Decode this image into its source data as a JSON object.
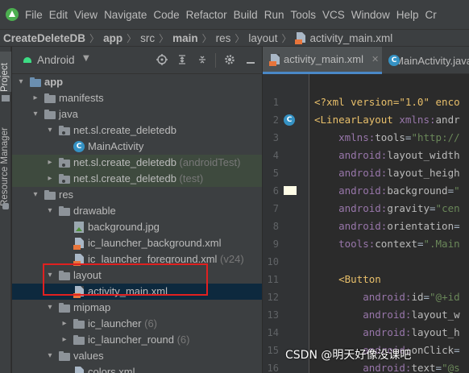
{
  "menu": [
    "File",
    "Edit",
    "View",
    "Navigate",
    "Code",
    "Refactor",
    "Build",
    "Run",
    "Tools",
    "VCS",
    "Window",
    "Help",
    "Cr"
  ],
  "breadcrumb": [
    "CreateDeleteDB",
    "app",
    "src",
    "main",
    "res",
    "layout",
    "activity_main.xml"
  ],
  "side_tabs": {
    "project": "Project",
    "resource_manager": "Resource Manager"
  },
  "project_panel": {
    "view_selector": "Android"
  },
  "tree": [
    {
      "label": "app",
      "bold": true,
      "suffix": ""
    },
    {
      "label": "manifests",
      "suffix": ""
    },
    {
      "label": "java",
      "suffix": ""
    },
    {
      "label": "net.sl.create_deletedb",
      "suffix": ""
    },
    {
      "label": "MainActivity",
      "suffix": ""
    },
    {
      "label": "net.sl.create_deletedb",
      "suffix": " (androidTest)"
    },
    {
      "label": "net.sl.create_deletedb",
      "suffix": " (test)"
    },
    {
      "label": "res",
      "suffix": ""
    },
    {
      "label": "drawable",
      "suffix": ""
    },
    {
      "label": "background.jpg",
      "suffix": ""
    },
    {
      "label": "ic_launcher_background.xml",
      "suffix": ""
    },
    {
      "label": "ic_launcher_foreground.xml",
      "suffix": " (v24)"
    },
    {
      "label": "layout",
      "suffix": ""
    },
    {
      "label": "activity_main.xml",
      "suffix": ""
    },
    {
      "label": "mipmap",
      "suffix": ""
    },
    {
      "label": "ic_launcher",
      "suffix": " (6)"
    },
    {
      "label": "ic_launcher_round",
      "suffix": " (6)"
    },
    {
      "label": "values",
      "suffix": ""
    },
    {
      "label": "colors.xml",
      "suffix": ""
    }
  ],
  "editor_tabs": [
    "activity_main.xml",
    "MainActivity.java"
  ],
  "line_numbers": [
    "1",
    "2",
    "3",
    "4",
    "5",
    "6",
    "7",
    "8",
    "9",
    "10",
    "11",
    "12",
    "13",
    "14",
    "15",
    "16"
  ],
  "code": [
    {
      "parts": [
        [
          "pre",
          "<?xml version=\"1.0\" enco"
        ]
      ]
    },
    {
      "parts": [
        [
          "tag",
          "<LinearLayout "
        ],
        [
          "ns",
          "xmlns:"
        ],
        [
          "attr",
          "andr"
        ]
      ]
    },
    {
      "parts": [
        [
          "plain",
          "    "
        ],
        [
          "ns",
          "xmlns:"
        ],
        [
          "attr",
          "tools"
        ],
        [
          "plain",
          "="
        ],
        [
          "val",
          "\"http://"
        ]
      ]
    },
    {
      "parts": [
        [
          "plain",
          "    "
        ],
        [
          "ns",
          "android:"
        ],
        [
          "attr",
          "layout_width"
        ]
      ]
    },
    {
      "parts": [
        [
          "plain",
          "    "
        ],
        [
          "ns",
          "android:"
        ],
        [
          "attr",
          "layout_heigh"
        ]
      ]
    },
    {
      "parts": [
        [
          "plain",
          "    "
        ],
        [
          "ns",
          "android:"
        ],
        [
          "attr",
          "background"
        ],
        [
          "plain",
          "="
        ],
        [
          "val",
          "\""
        ]
      ]
    },
    {
      "parts": [
        [
          "plain",
          "    "
        ],
        [
          "ns",
          "android:"
        ],
        [
          "attr",
          "gravity"
        ],
        [
          "plain",
          "="
        ],
        [
          "val",
          "\"cen"
        ]
      ]
    },
    {
      "parts": [
        [
          "plain",
          "    "
        ],
        [
          "ns",
          "android:"
        ],
        [
          "attr",
          "orientation"
        ],
        [
          "plain",
          "="
        ]
      ]
    },
    {
      "parts": [
        [
          "plain",
          "    "
        ],
        [
          "ns",
          "tools:"
        ],
        [
          "attr",
          "context"
        ],
        [
          "plain",
          "="
        ],
        [
          "val",
          "\".Main"
        ]
      ]
    },
    {
      "parts": [
        [
          "plain",
          ""
        ]
      ]
    },
    {
      "parts": [
        [
          "plain",
          "    "
        ],
        [
          "tag",
          "<Button"
        ]
      ]
    },
    {
      "parts": [
        [
          "plain",
          "        "
        ],
        [
          "ns",
          "android:"
        ],
        [
          "attr",
          "id"
        ],
        [
          "plain",
          "="
        ],
        [
          "val",
          "\"@+id"
        ]
      ]
    },
    {
      "parts": [
        [
          "plain",
          "        "
        ],
        [
          "ns",
          "android:"
        ],
        [
          "attr",
          "layout_w"
        ]
      ]
    },
    {
      "parts": [
        [
          "plain",
          "        "
        ],
        [
          "ns",
          "android:"
        ],
        [
          "attr",
          "layout_h"
        ]
      ]
    },
    {
      "parts": [
        [
          "plain",
          "        "
        ],
        [
          "ns",
          "android:"
        ],
        [
          "attr",
          "onClick"
        ],
        [
          "plain",
          "="
        ]
      ]
    },
    {
      "parts": [
        [
          "plain",
          "        "
        ],
        [
          "ns",
          "android:"
        ],
        [
          "attr",
          "text"
        ],
        [
          "plain",
          "="
        ],
        [
          "val",
          "\"@s"
        ]
      ]
    }
  ],
  "watermark": "CSDN @明天好像没课吧",
  "colors": {
    "selection": "#0d293e",
    "highlight_box": "#e02020",
    "tab_underline": "#4a88c7"
  }
}
